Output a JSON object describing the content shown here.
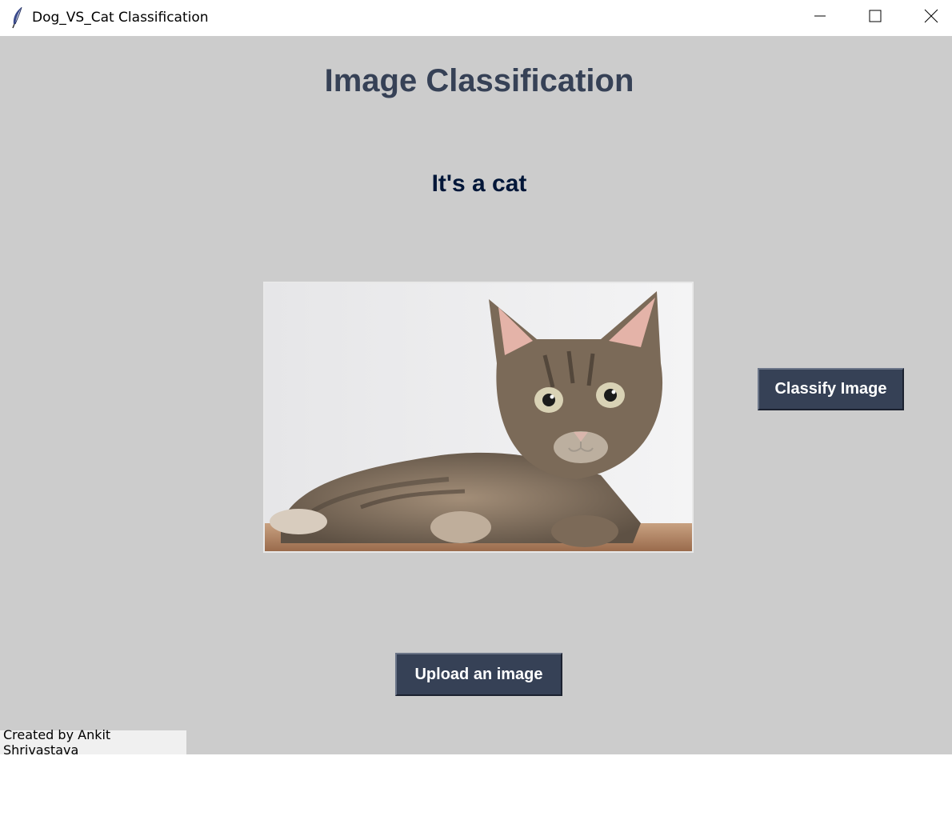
{
  "window": {
    "title": "Dog_VS_Cat Classification"
  },
  "app": {
    "heading": "Image Classification",
    "result": "It's a cat",
    "classify_label": "Classify Image",
    "upload_label": "Upload an image",
    "credit": "Created by Ankit Shrivastava"
  },
  "colors": {
    "background": "#cccccc",
    "button": "#364156",
    "heading": "#364156",
    "result": "#011638"
  },
  "icons": {
    "app_icon": "feather-icon",
    "minimize": "minimize-icon",
    "maximize": "maximize-icon",
    "close": "close-icon"
  }
}
